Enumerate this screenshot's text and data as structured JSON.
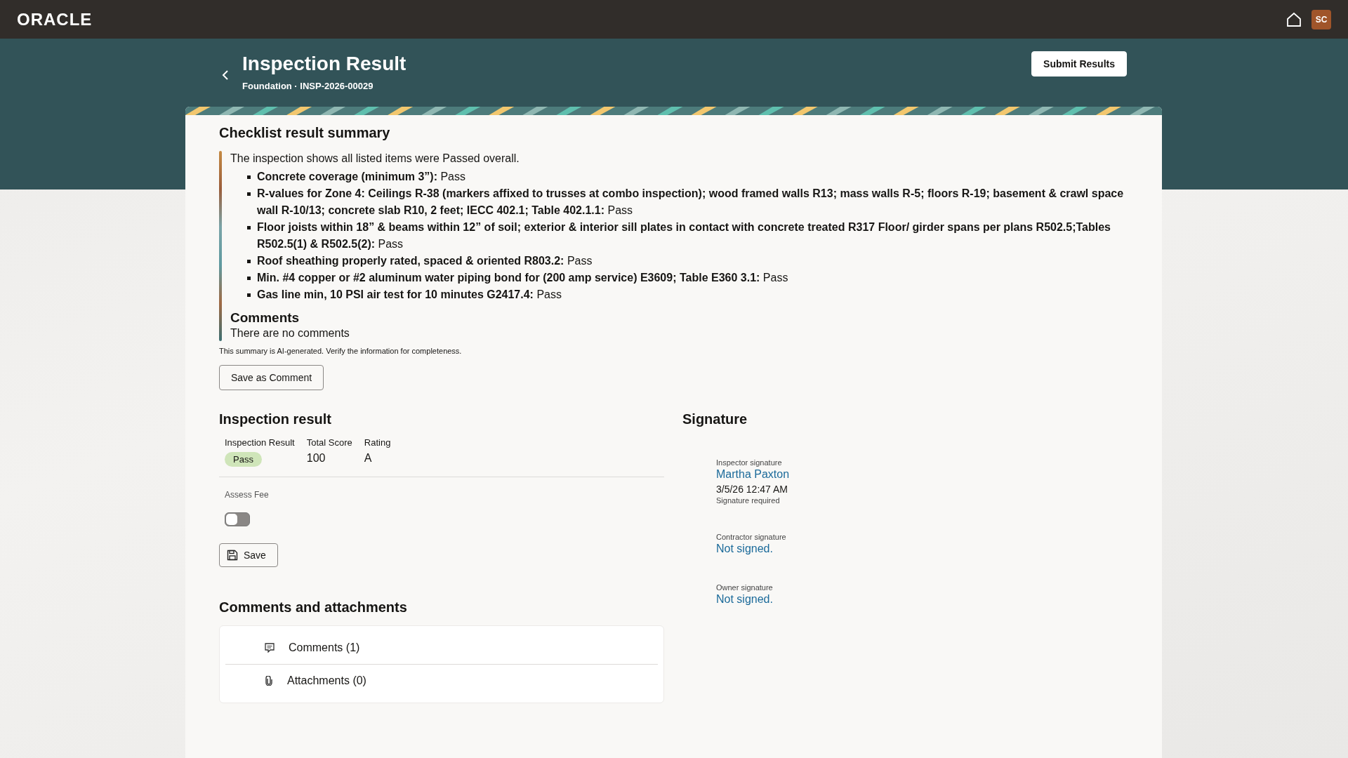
{
  "topbar": {
    "logo": "ORACLE",
    "avatar": "SC"
  },
  "page": {
    "title": "Inspection Result",
    "subtitle": "Foundation · INSP-2026-00029",
    "primary_button": "Submit Results"
  },
  "summary": {
    "heading": "Checklist result summary",
    "intro": "The inspection shows all listed items were Passed overall.",
    "items": [
      "**Concrete coverage (minimum 3”):** Pass",
      "**R-values for Zone 4: Ceilings R-38 (markers affixed to trusses at combo inspection); wood framed walls R13; mass walls R-5; floors R-19; basement & crawl space wall R-10/13; concrete slab R10, 2 feet; IECC 402.1; Table 402.1.1:** Pass",
      "**Floor joists within 18” & beams within 12” of soil; exterior & interior sill plates in contact with concrete treated R317 Floor/ girder spans per plans R502.5;Tables R502.5(1) & R502.5(2):** Pass",
      "**Roof sheathing properly rated, spaced & oriented R803.2:** Pass",
      "**Min. #4 copper or #2 aluminum water piping bond for (200 amp service) E3609; Table E360 3.1:** Pass",
      "**Gas line min, 10 PSI air test for 10 minutes G2417.4:** Pass"
    ],
    "comments_heading": "Comments",
    "comments_text": "There are no comments",
    "disclaimer": "This summary is AI-generated. Verify the information for completeness.",
    "button": "Save as Comment"
  },
  "inspection_result": {
    "heading": "Inspection result",
    "columns": [
      {
        "label": "Inspection Result",
        "value": "Pass",
        "kind": "badge"
      },
      {
        "label": "Total Score",
        "value": "100",
        "kind": "text"
      },
      {
        "label": "Rating",
        "value": "A",
        "kind": "text"
      }
    ],
    "assess_fee": {
      "label": "Assess Fee",
      "on": false
    },
    "save_button": "Save"
  },
  "signature": {
    "heading": "Signature",
    "entries": [
      {
        "label": "Inspector signature",
        "value": "Martha Paxton",
        "date": "3/5/26 12:47 AM",
        "note": "Signature required"
      },
      {
        "label": "Contractor signature",
        "value": "Not signed."
      },
      {
        "label": "Owner signature",
        "value": "Not signed."
      }
    ]
  },
  "comments_attachments": {
    "heading": "Comments and attachments",
    "items": [
      {
        "label": "Comments (1)",
        "kind": "comments"
      },
      {
        "label": "Attachments (0)",
        "kind": "attachments"
      }
    ]
  }
}
